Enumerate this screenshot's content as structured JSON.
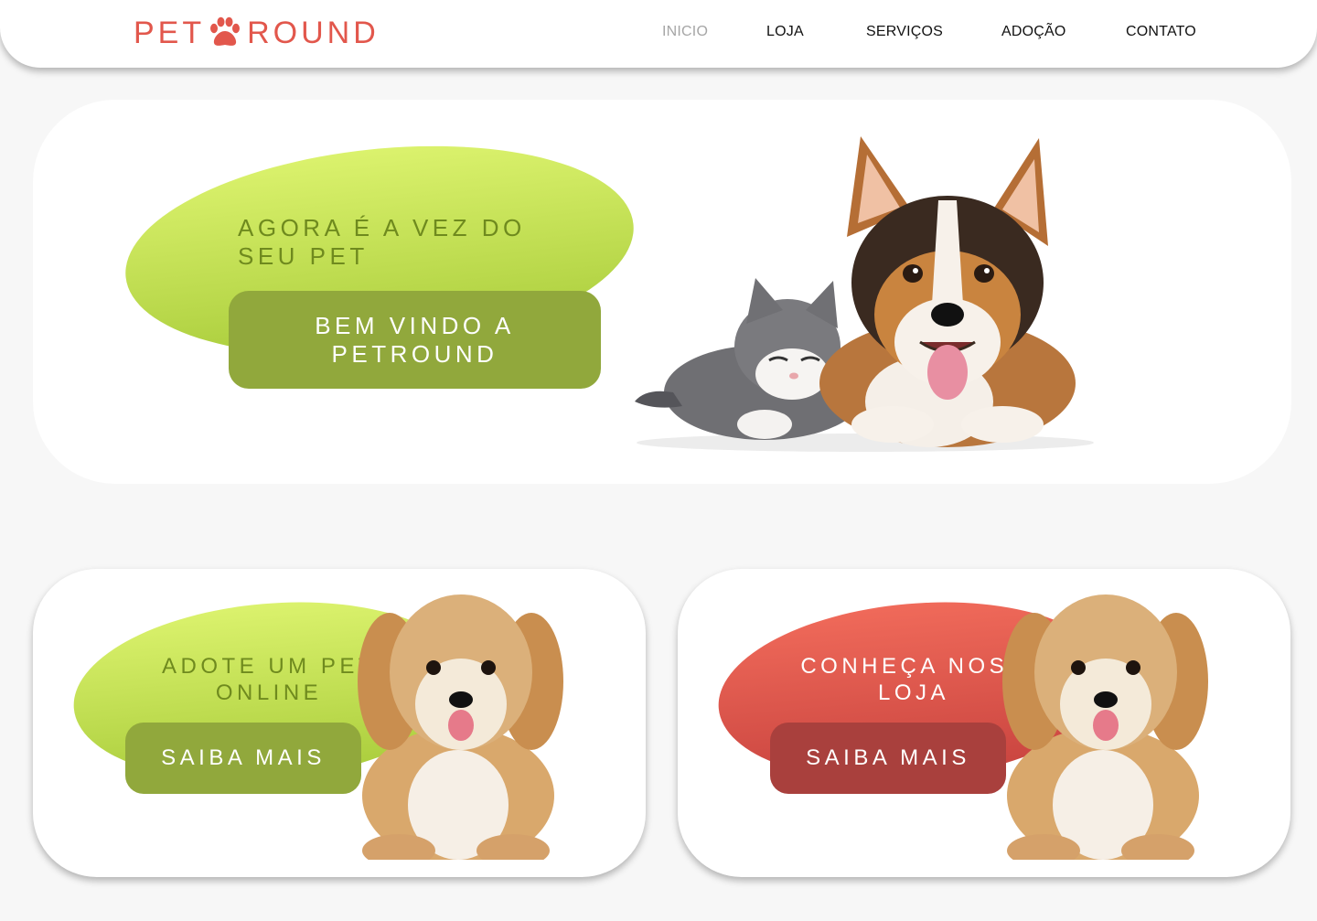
{
  "brand": {
    "name_left": "PET",
    "name_right": "ROUND",
    "logo_icon": "paw-icon",
    "color": "#e2574c"
  },
  "nav": {
    "items": [
      {
        "label": "INICIO",
        "active": true
      },
      {
        "label": "LOJA",
        "active": false
      },
      {
        "label": "SERVIÇOS",
        "active": false
      },
      {
        "label": "ADOÇÃO",
        "active": false
      },
      {
        "label": "CONTATO",
        "active": false
      }
    ]
  },
  "hero": {
    "headline": "AGORA É A VEZ DO SEU PET",
    "cta_line1": "BEM VINDO A",
    "cta_line2": "PETROUND",
    "image": "corgi-puppy-and-kitten-photo"
  },
  "promos": [
    {
      "headline": "ADOTE UM PET ONLINE",
      "cta": "SAIBA MAIS",
      "image": "fluffy-puppy-photo",
      "accent": "#91a83c"
    },
    {
      "headline": "CONHEÇA NOSA LOJA",
      "cta": "SAIBA MAIS",
      "image": "fluffy-puppy-photo",
      "accent": "#a9403d"
    }
  ],
  "colors": {
    "green_light": "#dbf26d",
    "green_dark": "#91a83c",
    "red_light": "#f06a5a",
    "red_dark": "#a9403d",
    "background": "#f7f7f7"
  }
}
